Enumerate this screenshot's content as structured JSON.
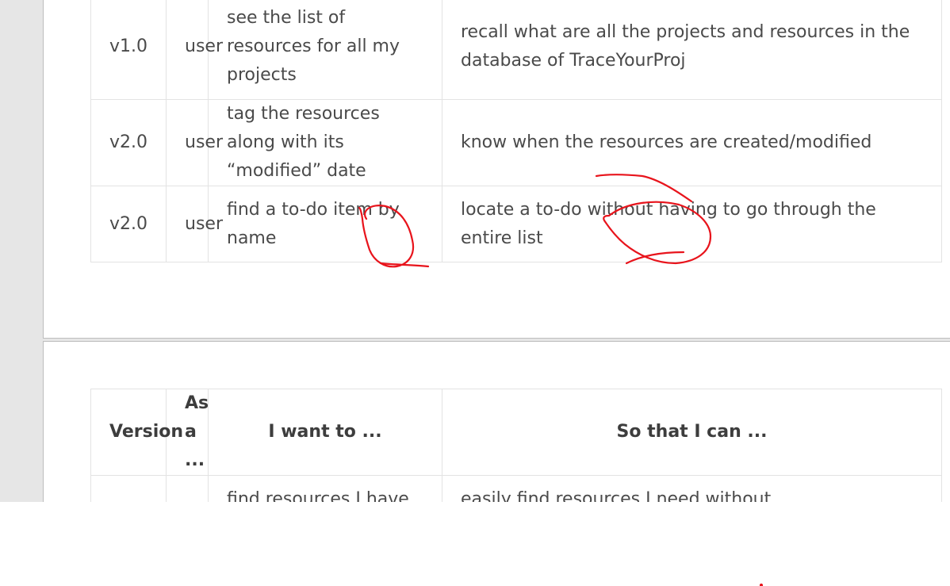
{
  "table_top": {
    "partial_row": {
      "want": "resources"
    },
    "rows": [
      {
        "version": "v1.0",
        "role": "user",
        "want": "see the list of resources for all my projects",
        "so_that": "recall what are all the projects and resources in the database of TraceYourProj"
      },
      {
        "version": "v2.0",
        "role": "user",
        "want": "tag the resources along with its “modified” date",
        "so_that": "know when the resources are created/modified"
      },
      {
        "version": "v2.0",
        "role": "user",
        "want": "find a to-do item by name",
        "so_that": "locate a to-do without having to go through the entire list"
      }
    ]
  },
  "table_bottom": {
    "headers": {
      "version": "Version",
      "role": "As a ...",
      "want": "I want to ...",
      "so_that": "So that I can ..."
    },
    "rows": [
      {
        "version": "",
        "role": "",
        "want": "find resources I have that",
        "so_that": "easily find resources I need without"
      }
    ]
  },
  "annotations": {
    "ink_color": "#e8141c",
    "marks": [
      "circle-around-to-do-want",
      "strikethrough-created",
      "circle-around-to-do-so-that",
      "strikethrough-the"
    ]
  }
}
